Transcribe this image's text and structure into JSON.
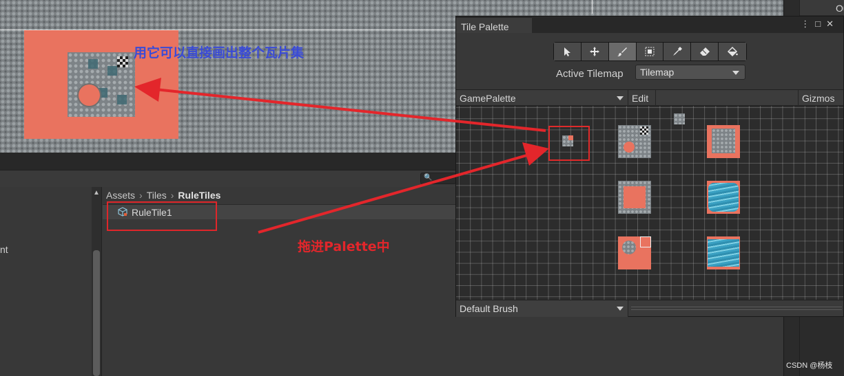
{
  "scene": {
    "annotation_blue": "用它可以直接画出整个瓦片集"
  },
  "inspector": {
    "title_partial": "Outp"
  },
  "project": {
    "breadcrumb": {
      "p1": "Assets",
      "p2": "Tiles",
      "p3": "RuleTiles"
    },
    "asset_name": "RuleTile1",
    "tree_partial": "nt",
    "search_icon": "🔍"
  },
  "palette": {
    "tab_title": "Tile Palette",
    "window_controls": "⋮□✕",
    "tools": [
      "select-icon",
      "move-icon",
      "paint-brush-icon",
      "box-fill-icon",
      "picker-icon",
      "eraser-icon",
      "flood-fill-icon"
    ],
    "active_tool_index": 2,
    "active_tilemap_label": "Active Tilemap",
    "active_tilemap_value": "Tilemap",
    "palette_name": "GamePalette",
    "edit_label": "Edit",
    "gizmos_label": "Gizmos",
    "brush_label": "Default Brush"
  },
  "annotations": {
    "drag_hint": "拖进Palette中",
    "watermark": "CSDN @杨枝"
  },
  "colors": {
    "annotation_red": "#e3262b",
    "annotation_blue": "#3a4bd6",
    "tile_orange": "#e9735f"
  }
}
